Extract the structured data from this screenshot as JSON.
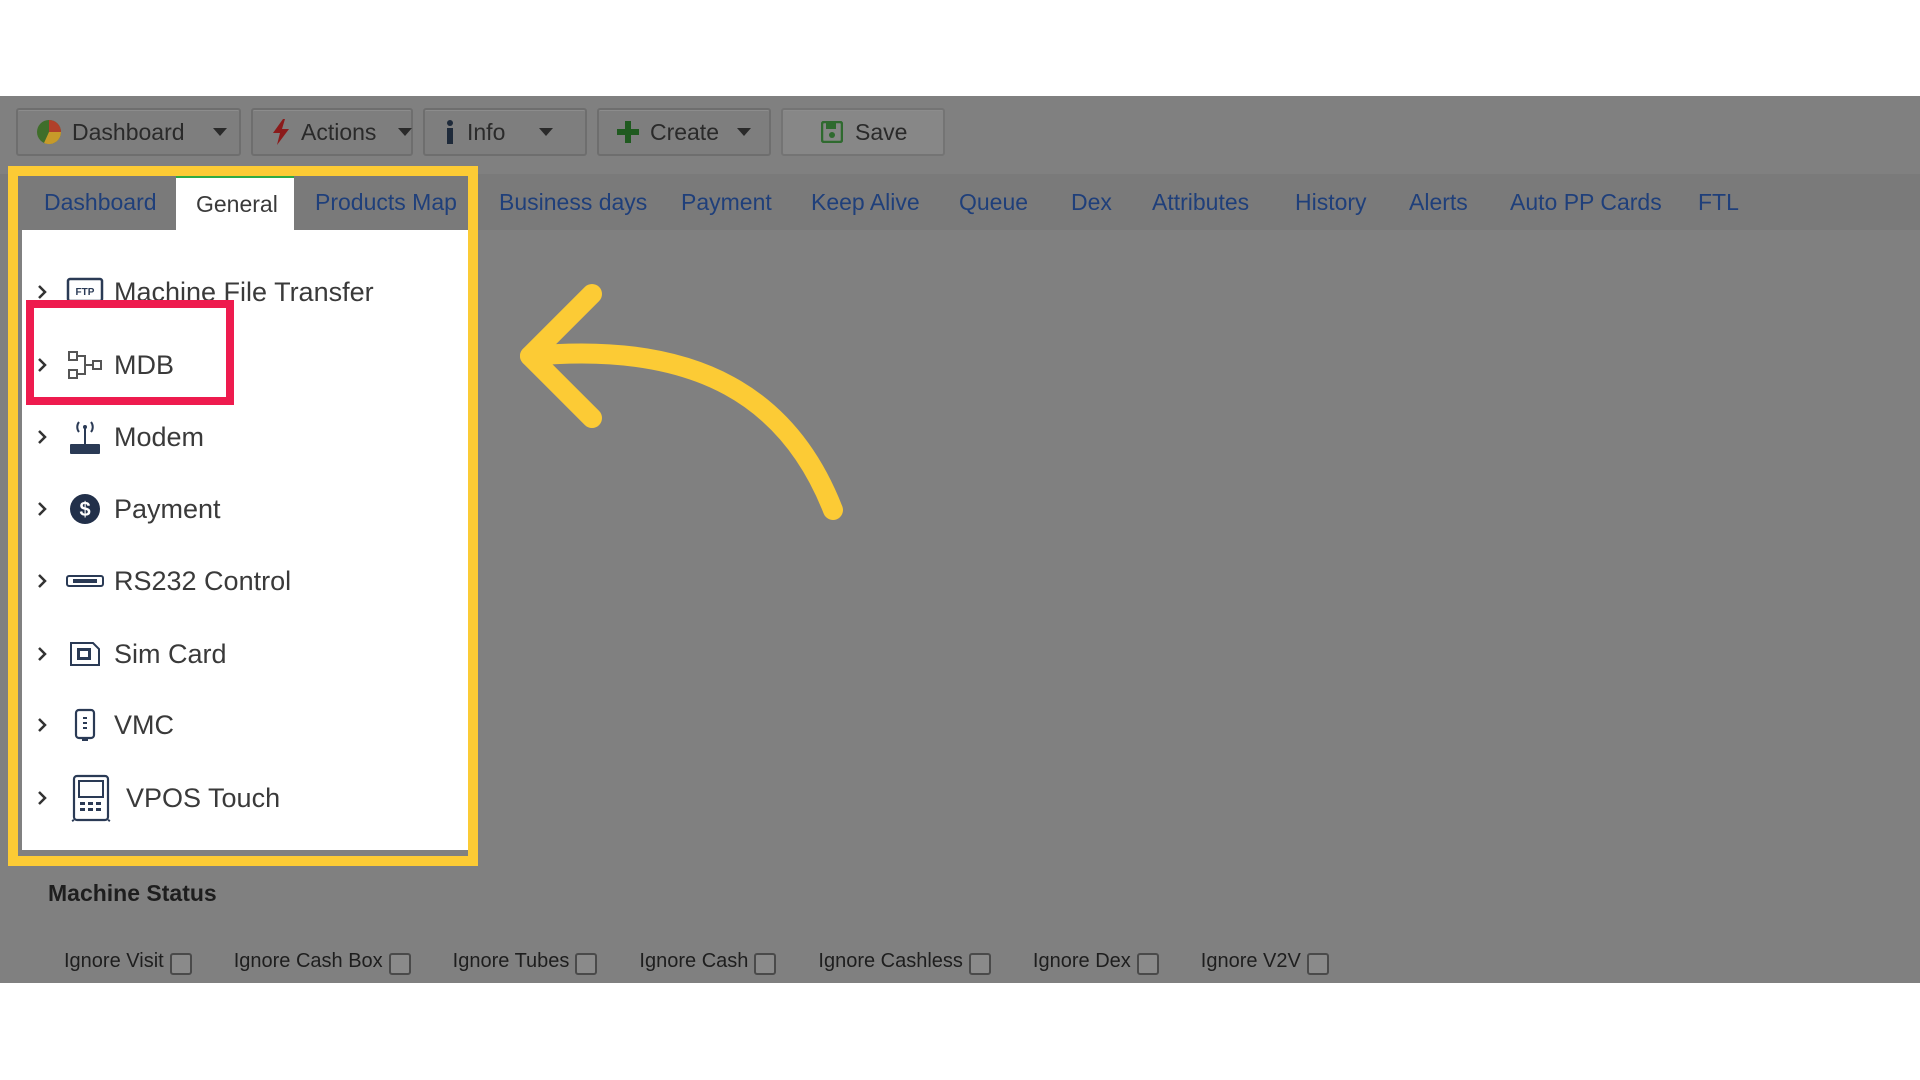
{
  "toolbar": {
    "dashboard_label": "Dashboard",
    "actions_label": "Actions",
    "info_label": "Info",
    "create_label": "Create",
    "save_label": "Save"
  },
  "tabs": [
    {
      "label": "Dashboard",
      "active": false
    },
    {
      "label": "General",
      "active": true
    },
    {
      "label": "Products Map",
      "active": false
    },
    {
      "label": "Business days",
      "active": false
    },
    {
      "label": "Payment",
      "active": false
    },
    {
      "label": "Keep Alive",
      "active": false
    },
    {
      "label": "Queue",
      "active": false
    },
    {
      "label": "Dex",
      "active": false
    },
    {
      "label": "Attributes",
      "active": false
    },
    {
      "label": "History",
      "active": false
    },
    {
      "label": "Alerts",
      "active": false
    },
    {
      "label": "Auto PP Cards",
      "active": false
    },
    {
      "label": "FTL",
      "active": false
    }
  ],
  "tree": {
    "items": [
      {
        "label": "Machine File Transfer",
        "icon": "ftp-icon"
      },
      {
        "label": "MDB",
        "icon": "mdb-icon"
      },
      {
        "label": "Modem",
        "icon": "modem-icon"
      },
      {
        "label": "Payment",
        "icon": "dollar-icon"
      },
      {
        "label": "RS232 Control",
        "icon": "serial-port-icon"
      },
      {
        "label": "Sim Card",
        "icon": "sim-card-icon"
      },
      {
        "label": "VMC",
        "icon": "vmc-icon"
      },
      {
        "label": "VPOS Touch",
        "icon": "vpos-terminal-icon"
      }
    ]
  },
  "ftp_icon_text": "FTP",
  "machine_status": {
    "title": "Machine Status",
    "checkboxes": [
      {
        "label": "Ignore Visit",
        "checked": false
      },
      {
        "label": "Ignore Cash Box",
        "checked": false
      },
      {
        "label": "Ignore Tubes",
        "checked": false
      },
      {
        "label": "Ignore Cash",
        "checked": false
      },
      {
        "label": "Ignore Cashless",
        "checked": false
      },
      {
        "label": "Ignore Dex",
        "checked": false
      },
      {
        "label": "Ignore V2V",
        "checked": false
      }
    ]
  },
  "colors": {
    "overlay_gray": "#808080",
    "tab_link": "#1f3f7a",
    "active_tab_border": "#2faa44",
    "yellow_highlight": "#fccb35",
    "red_highlight": "#ee1b4e"
  }
}
